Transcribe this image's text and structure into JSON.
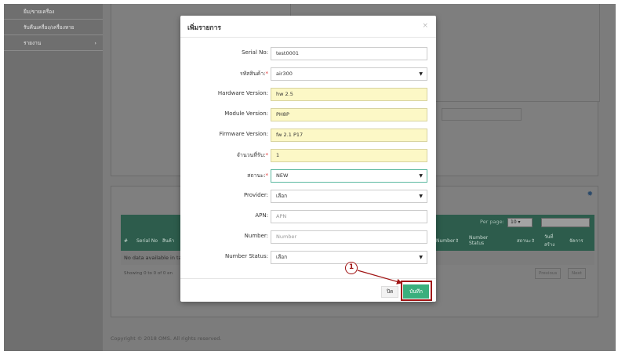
{
  "sidebar": {
    "items": [
      {
        "label": "ยืม/ขายเครื่อง"
      },
      {
        "label": "รับคืนเครื่อง/เครื่องหาย"
      },
      {
        "label": "รายงาน",
        "chevron": "›"
      }
    ]
  },
  "table": {
    "per_page_label": "Per page:",
    "per_page_value": "10",
    "headers": [
      "Serial No",
      "สินค้า",
      "Number",
      "Number Status",
      "สถานะ",
      "วันที่ สร้าง",
      "จัดการ"
    ],
    "empty_text": "No data available in ta",
    "showing_text": "Showing 0 to 0 of 0 en",
    "previous": "Previous",
    "next": "Next"
  },
  "footer": {
    "copyright": "Copyright © 2018 OMS. All rights reserved."
  },
  "modal": {
    "title": "เพิ่มรายการ",
    "close_glyph": "×",
    "fields": {
      "serial_no": {
        "label": "Serial No:",
        "value": "test0001"
      },
      "product_code": {
        "label": "รหัสสินค้า:",
        "value": "air300"
      },
      "hardware_version": {
        "label": "Hardware Version:",
        "value": "hw 2.5"
      },
      "module_version": {
        "label": "Module Version:",
        "value": "PH8P"
      },
      "firmware_version": {
        "label": "Firmware Version:",
        "value": "fw 2.1 P17"
      },
      "received_qty": {
        "label": "จำนวนที่รับ:",
        "value": "1"
      },
      "status": {
        "label": "สถานะ:",
        "value": "NEW"
      },
      "provider": {
        "label": "Provider:",
        "value": "เลือก"
      },
      "apn": {
        "label": "APN:",
        "placeholder": "APN"
      },
      "number": {
        "label": "Number:",
        "placeholder": "Number"
      },
      "number_status": {
        "label": "Number Status:",
        "value": "เลือก"
      }
    },
    "required_mark": "*",
    "close_button": "ปิด",
    "save_button": "บันทึก"
  },
  "annotation": {
    "step_number": "1"
  },
  "colors": {
    "accent": "#3aaf7d",
    "highlight": "#a01414",
    "table_header": "#2d5c4c"
  }
}
